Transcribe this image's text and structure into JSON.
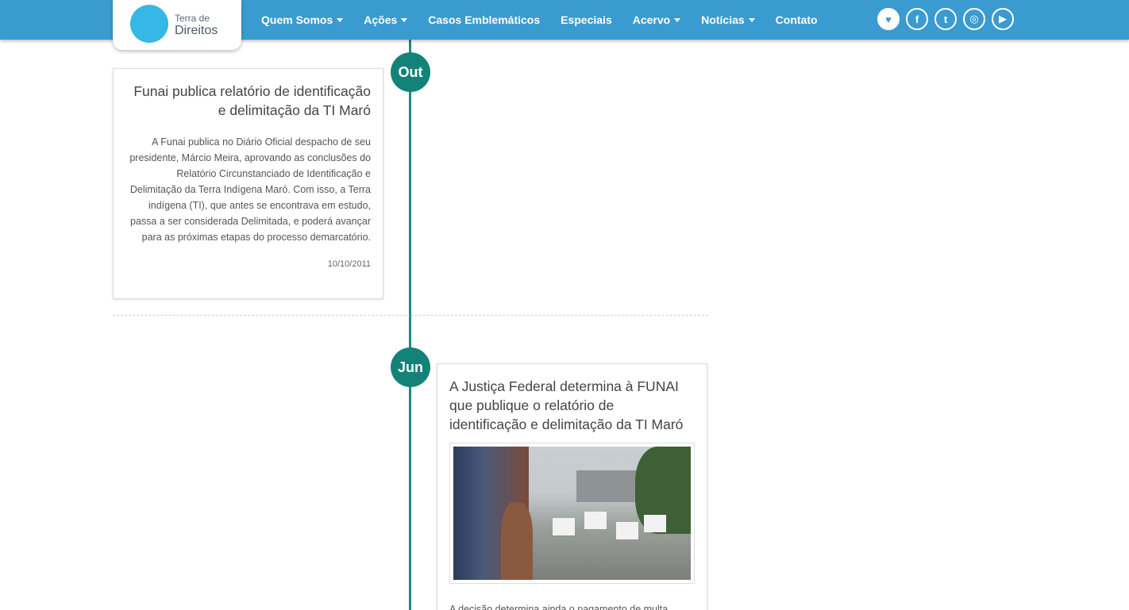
{
  "header": {
    "logo_line1": "Terra de",
    "logo_line2": "Direitos",
    "nav": [
      {
        "label": "Quem Somos",
        "dropdown": true
      },
      {
        "label": "Ações",
        "dropdown": true
      },
      {
        "label": "Casos Emblemáticos",
        "dropdown": false
      },
      {
        "label": "Especiais",
        "dropdown": false
      },
      {
        "label": "Acervo",
        "dropdown": true
      },
      {
        "label": "Notícias",
        "dropdown": true
      },
      {
        "label": "Contato",
        "dropdown": false
      }
    ],
    "social": [
      {
        "icon": "donate-hand-icon",
        "glyph": "♥"
      },
      {
        "icon": "facebook-icon",
        "glyph": "f"
      },
      {
        "icon": "twitter-icon",
        "glyph": "t"
      },
      {
        "icon": "instagram-icon",
        "glyph": "◎"
      },
      {
        "icon": "youtube-icon",
        "glyph": "▶"
      }
    ]
  },
  "colors": {
    "header_bg": "#3a9bd0",
    "timeline": "#138379"
  },
  "timeline": {
    "months": [
      "Out",
      "Jun"
    ],
    "entries": [
      {
        "title": "Funai publica relatório de identificação e delimitação da TI Maró",
        "body": "A Funai publica no Diário Oficial despacho de seu presidente, Márcio Meira, aprovando as conclusões do Relatório Circunstanciado de Identificação e Delimitação da Terra Indígena Maró. Com isso, a Terra indígena (TI), que antes se encontrava em estudo, passa a ser considerada Delimitada, e poderá avançar para as próximas etapas do processo demarcatório.",
        "date": "10/10/2011"
      },
      {
        "title": "A Justiça Federal determina à FUNAI que publique o relatório de identificação e delimitação da TI Maró",
        "body": "A decisão determina ainda o pagamento de multa"
      }
    ]
  }
}
